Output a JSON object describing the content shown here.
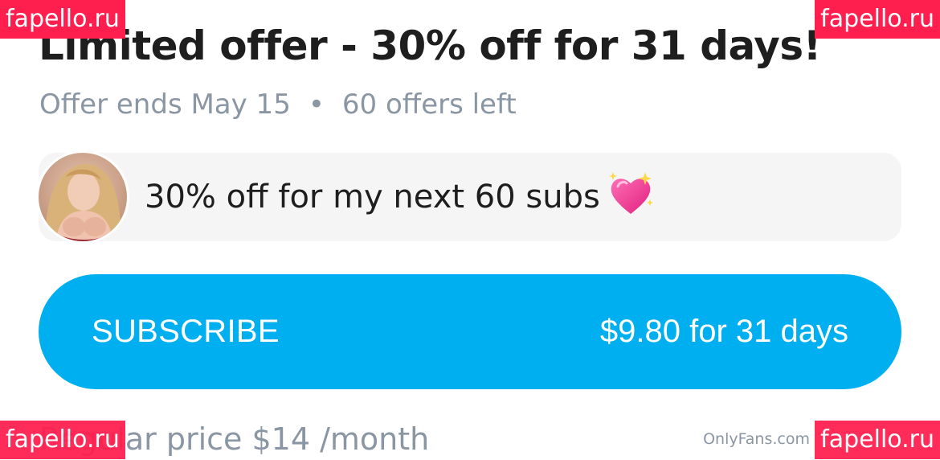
{
  "offer": {
    "title": "Limited offer - 30% off for 31 days!",
    "ends": "Offer ends May 15",
    "separator": "•",
    "remaining": "60 offers left"
  },
  "message": {
    "text": "30% off for my next 60 subs",
    "emoji_icon": "sparkling-heart-icon"
  },
  "subscribe": {
    "label": "SUBSCRIBE",
    "price": "$9.80 for 31 days",
    "color": "#00aff0"
  },
  "regular_price": "Regular price $14 /month",
  "footer_brand": "OnlyFans.com",
  "watermarks": {
    "top_left": "fapello.ru",
    "top_right": "fapello.ru",
    "bottom_left": "fapello.ru",
    "bottom_right": "fapello.ru"
  },
  "colors": {
    "muted_text": "#8a96a3",
    "message_bg": "#f5f5f6",
    "watermark": "#ff1f4f"
  }
}
